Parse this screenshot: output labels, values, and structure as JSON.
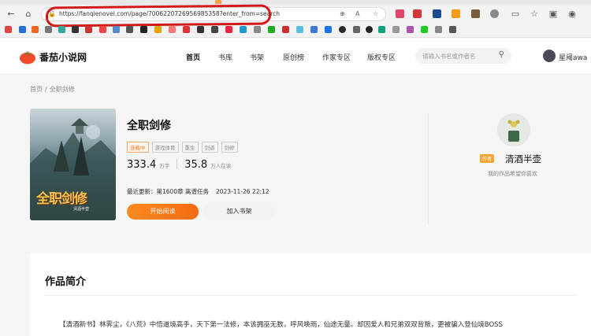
{
  "browser": {
    "url": "https://fanqienovel.com/page/7006220726956985358?enter_from=search"
  },
  "header": {
    "logo_text": "番茄小说网",
    "nav": [
      "首页",
      "书库",
      "书架",
      "原创榜",
      "作家专区",
      "版权专区"
    ],
    "search_placeholder": "请输入书名或作者名",
    "user_name": "星阈awa"
  },
  "breadcrumb": {
    "home": "首页",
    "sep": "/",
    "current": "全职剑修"
  },
  "book": {
    "title": "全职剑修",
    "cover_title": "全职剑修",
    "cover_author": "清酒半壶",
    "tags": [
      "连载中",
      "游戏体育",
      "重生",
      "剑道",
      "剑修"
    ],
    "word_count": "333.4",
    "word_unit": "万字",
    "readers": "35.8",
    "readers_unit": "万人在读",
    "update_label": "最近更新：第1600章 离谱任务",
    "update_time": "2023-11-26 22:12",
    "read_button": "开始阅读",
    "shelf_button": "加入书架"
  },
  "author": {
    "badge": "作者",
    "name": "清酒半壶",
    "signature": "我的作品希望你喜欢"
  },
  "intro": {
    "title": "作品简介",
    "text": "【清酒新书】林霁尘，《八荒》中悟道境高手，天下第一法修，本该拥巫无数，呼风唤雨，仙途无量。却因爱人和兄弟双双背叛，更被骗入登仙境BOSS"
  },
  "colors": {
    "accent": "#f66a12",
    "annotation": "#d11a1a"
  }
}
